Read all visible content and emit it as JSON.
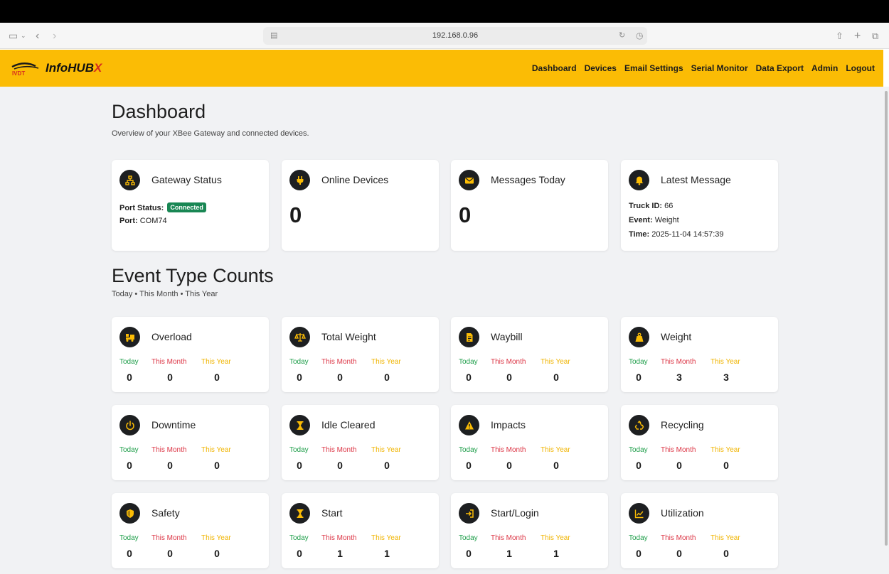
{
  "browser": {
    "url": "192.168.0.96"
  },
  "brand": {
    "name_main": "InfoHUB",
    "name_accent": "X",
    "logo_text": "IVDT"
  },
  "nav": [
    "Dashboard",
    "Devices",
    "Email Settings",
    "Serial Monitor",
    "Data Export",
    "Admin",
    "Logout"
  ],
  "page": {
    "title": "Dashboard",
    "subtitle": "Overview of your XBee Gateway and connected devices."
  },
  "gateway": {
    "title": "Gateway Status",
    "port_status_label": "Port Status:",
    "port_status_value": "Connected",
    "port_label": "Port:",
    "port_value": "COM74",
    "icon": "network-icon"
  },
  "online_devices": {
    "title": "Online Devices",
    "value": "0",
    "icon": "plug-icon"
  },
  "messages_today": {
    "title": "Messages Today",
    "value": "0",
    "icon": "envelope-icon"
  },
  "latest_message": {
    "title": "Latest Message",
    "icon": "bell-icon",
    "truck_label": "Truck ID:",
    "truck_value": "66",
    "event_label": "Event:",
    "event_value": "Weight",
    "time_label": "Time:",
    "time_value": "2025-11-04 14:57:39"
  },
  "events_section": {
    "title": "Event Type Counts",
    "subtitle": "Today • This Month • This Year"
  },
  "labels": {
    "today": "Today",
    "month": "This Month",
    "year": "This Year"
  },
  "events": [
    {
      "name": "Overload",
      "icon": "truck-load-icon",
      "today": "0",
      "month": "0",
      "year": "0"
    },
    {
      "name": "Total Weight",
      "icon": "scale-icon",
      "today": "0",
      "month": "0",
      "year": "0"
    },
    {
      "name": "Waybill",
      "icon": "document-icon",
      "today": "0",
      "month": "0",
      "year": "0"
    },
    {
      "name": "Weight",
      "icon": "weight-icon",
      "today": "0",
      "month": "3",
      "year": "3"
    },
    {
      "name": "Downtime",
      "icon": "power-icon",
      "today": "0",
      "month": "0",
      "year": "0"
    },
    {
      "name": "Idle Cleared",
      "icon": "hourglass-icon",
      "today": "0",
      "month": "0",
      "year": "0"
    },
    {
      "name": "Impacts",
      "icon": "warning-icon",
      "today": "0",
      "month": "0",
      "year": "0"
    },
    {
      "name": "Recycling",
      "icon": "recycle-icon",
      "today": "0",
      "month": "0",
      "year": "0"
    },
    {
      "name": "Safety",
      "icon": "shield-icon",
      "today": "0",
      "month": "0",
      "year": "0"
    },
    {
      "name": "Start",
      "icon": "hourglass-icon",
      "today": "0",
      "month": "1",
      "year": "1"
    },
    {
      "name": "Start/Login",
      "icon": "login-icon",
      "today": "0",
      "month": "1",
      "year": "1"
    },
    {
      "name": "Utilization",
      "icon": "chart-line-icon",
      "today": "0",
      "month": "0",
      "year": "0"
    }
  ],
  "colors": {
    "brand_yellow": "#fbbc05",
    "today": "#1e9e4a",
    "month": "#dc3545",
    "year": "#f0b400",
    "connected": "#198754"
  }
}
